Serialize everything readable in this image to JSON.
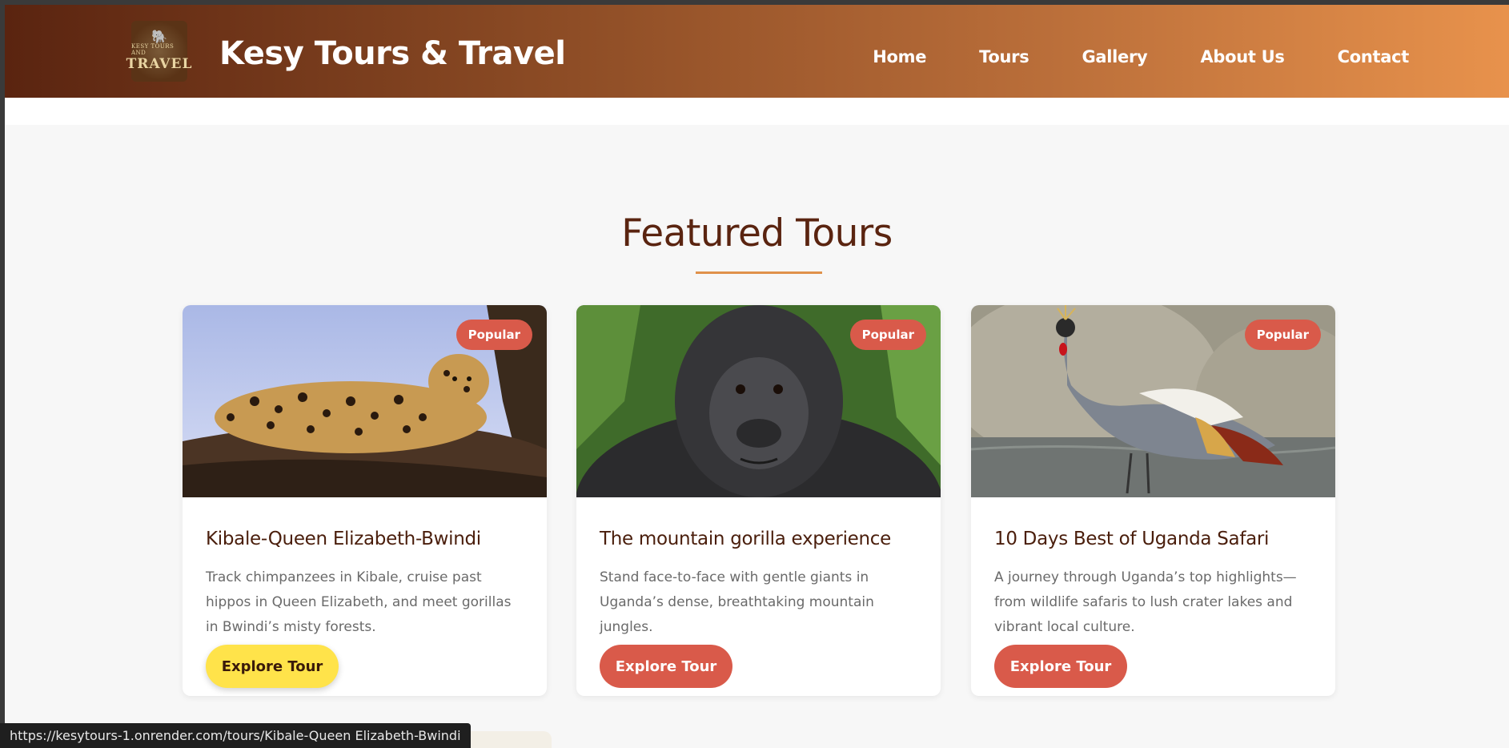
{
  "header": {
    "logo_line1": "KESY TOURS AND",
    "logo_line2": "TRAVEL",
    "brand": "Kesy Tours & Travel",
    "nav": [
      "Home",
      "Tours",
      "Gallery",
      "About Us",
      "Contact"
    ]
  },
  "section": {
    "title": "Featured Tours"
  },
  "tours": [
    {
      "badge": "Popular",
      "title": "Kibale-Queen Elizabeth-Bwindi",
      "description": "Track chimpanzees in Kibale, cruise past hippos in Queen Elizabeth, and meet gorillas in Bwindi’s misty forests.",
      "button": "Explore Tour",
      "image": "leopard-on-tree"
    },
    {
      "badge": "Popular",
      "title": "The mountain gorilla experience",
      "description": "Stand face-to-face with gentle giants in Uganda’s dense, breathtaking mountain jungles.",
      "button": "Explore Tour",
      "image": "mountain-gorilla"
    },
    {
      "badge": "Popular",
      "title": "10 Days Best of Uganda Safari",
      "description": "A journey through Uganda’s top highlights—from wildlife safaris to lush crater lakes and vibrant local culture.",
      "button": "Explore Tour",
      "image": "crowned-crane"
    }
  ],
  "status_bar": {
    "url": "https://kesytours-1.onrender.com/tours/Kibale-Queen Elizabeth-Bwindi"
  },
  "colors": {
    "header_start": "#5a2410",
    "header_end": "#e8924c",
    "accent_red": "#d95a4a",
    "accent_yellow": "#ffe34a",
    "title_brown": "#5a2410"
  }
}
